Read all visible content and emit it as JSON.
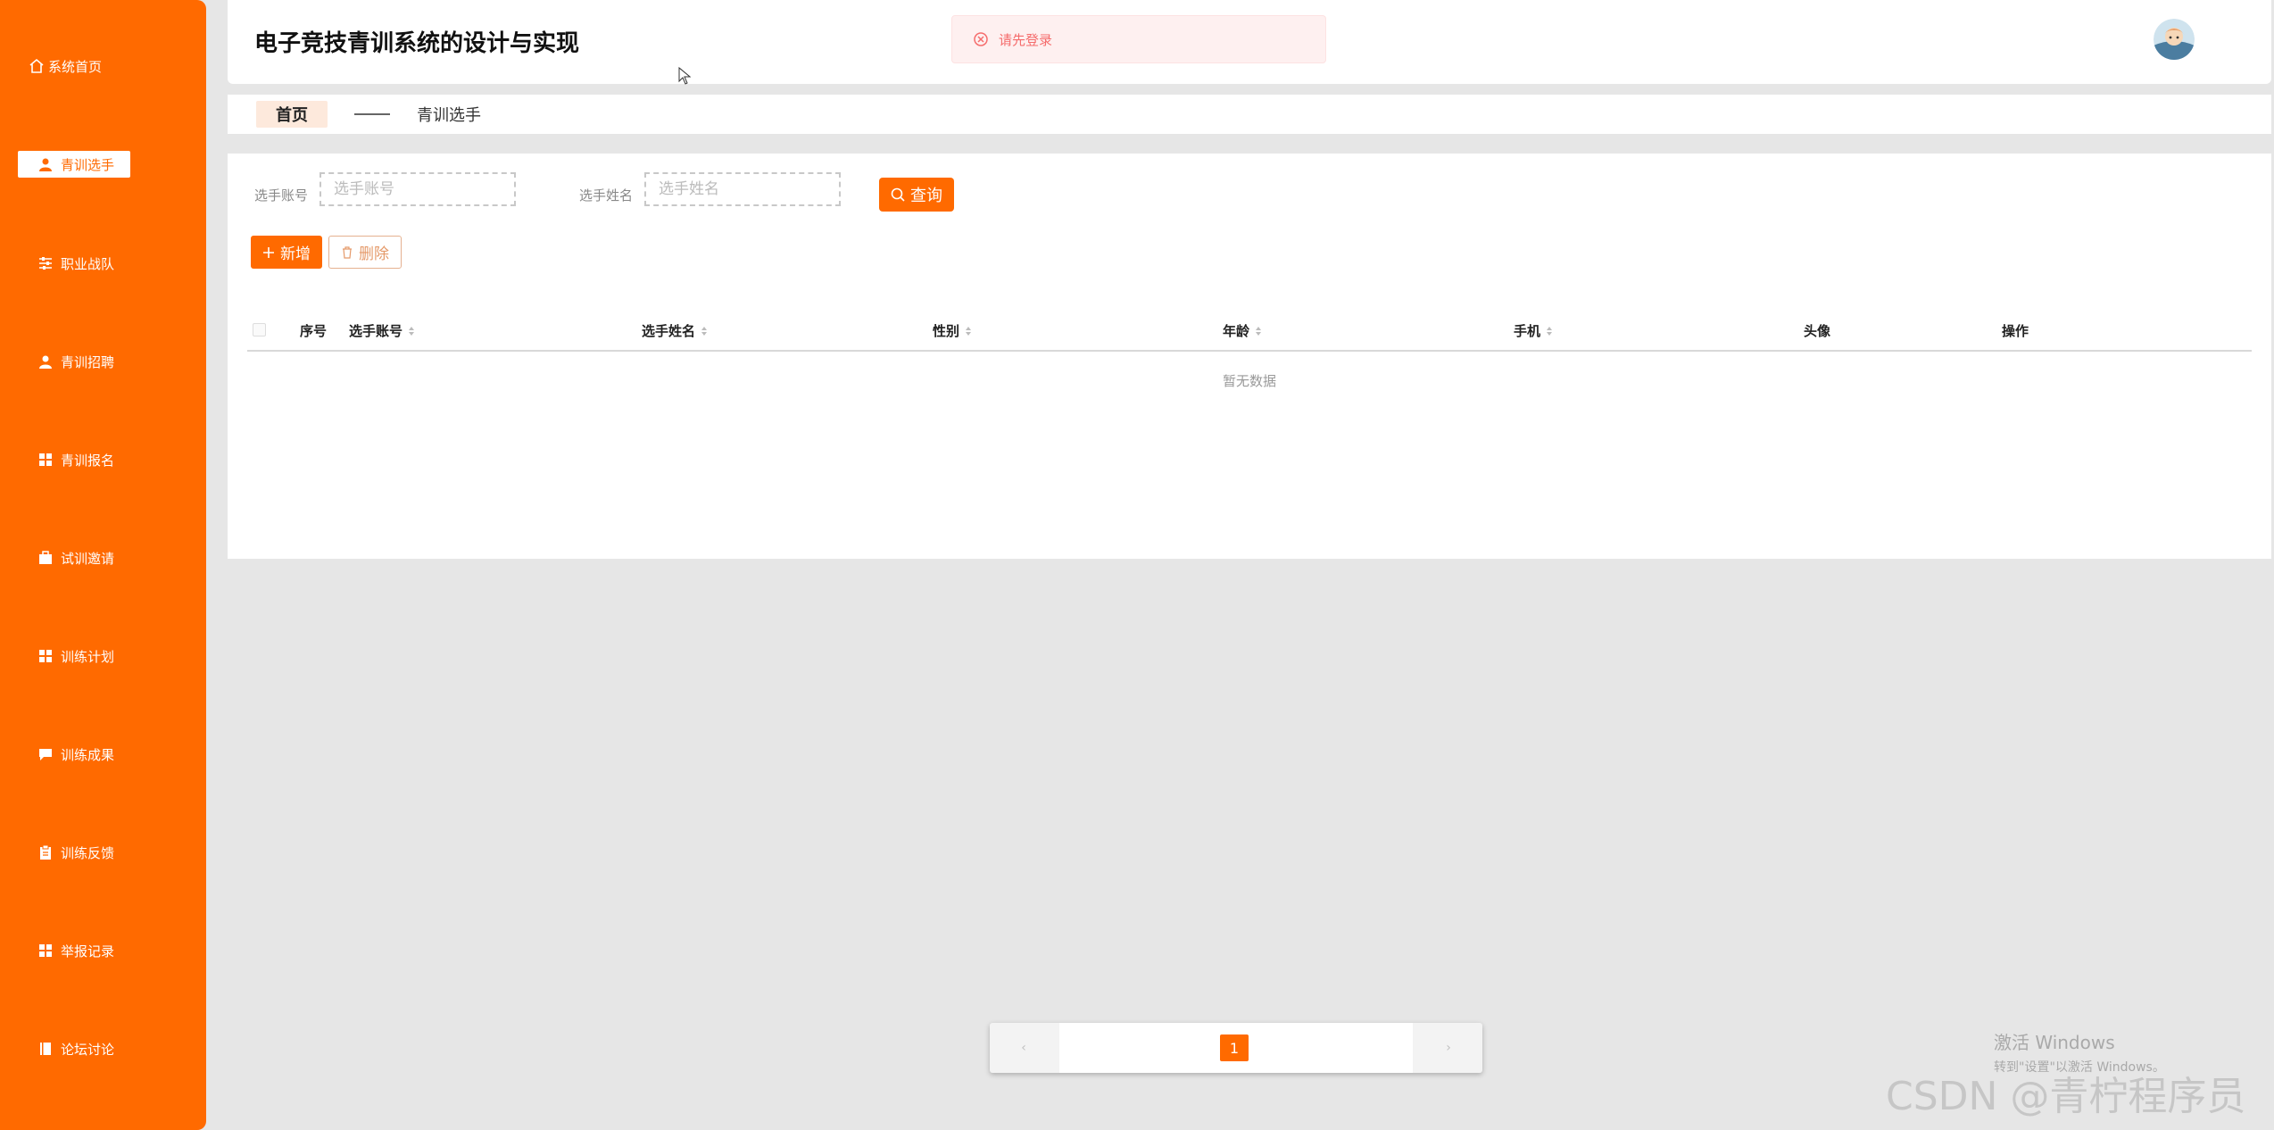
{
  "app": {
    "title": "电子竞技青训系统的设计与实现"
  },
  "toast": {
    "message": "请先登录"
  },
  "sidebar": {
    "items": [
      {
        "label": "系统首页",
        "icon": "home-icon"
      },
      {
        "label": "青训选手",
        "icon": "user-icon",
        "active": true
      },
      {
        "label": "职业战队",
        "icon": "sliders-icon"
      },
      {
        "label": "青训招聘",
        "icon": "user-icon"
      },
      {
        "label": "青训报名",
        "icon": "grid-icon"
      },
      {
        "label": "试训邀请",
        "icon": "briefcase-icon"
      },
      {
        "label": "训练计划",
        "icon": "grid-icon"
      },
      {
        "label": "训练成果",
        "icon": "chat-icon"
      },
      {
        "label": "训练反馈",
        "icon": "clipboard-icon"
      },
      {
        "label": "举报记录",
        "icon": "grid-icon"
      },
      {
        "label": "论坛讨论",
        "icon": "book-icon"
      }
    ]
  },
  "breadcrumb": {
    "home": "首页",
    "current": "青训选手"
  },
  "search": {
    "account_label": "选手账号",
    "account_placeholder": "选手账号",
    "name_label": "选手姓名",
    "name_placeholder": "选手姓名",
    "query_label": "查询"
  },
  "actions": {
    "add_label": "新增",
    "delete_label": "删除"
  },
  "table": {
    "columns": [
      "序号",
      "选手账号",
      "选手姓名",
      "性别",
      "年龄",
      "手机",
      "头像",
      "操作"
    ],
    "empty_text": "暂无数据"
  },
  "pagination": {
    "current_page": "1",
    "prev": "‹",
    "next": "›"
  },
  "watermark": {
    "windows_line1": "激活 Windows",
    "windows_line2": "转到\"设置\"以激活 Windows。",
    "csdn": "CSDN @青柠程序员"
  },
  "colors": {
    "accent": "#ff6a00",
    "toast_text": "#f56c6c",
    "toast_bg": "#fef0f0"
  }
}
